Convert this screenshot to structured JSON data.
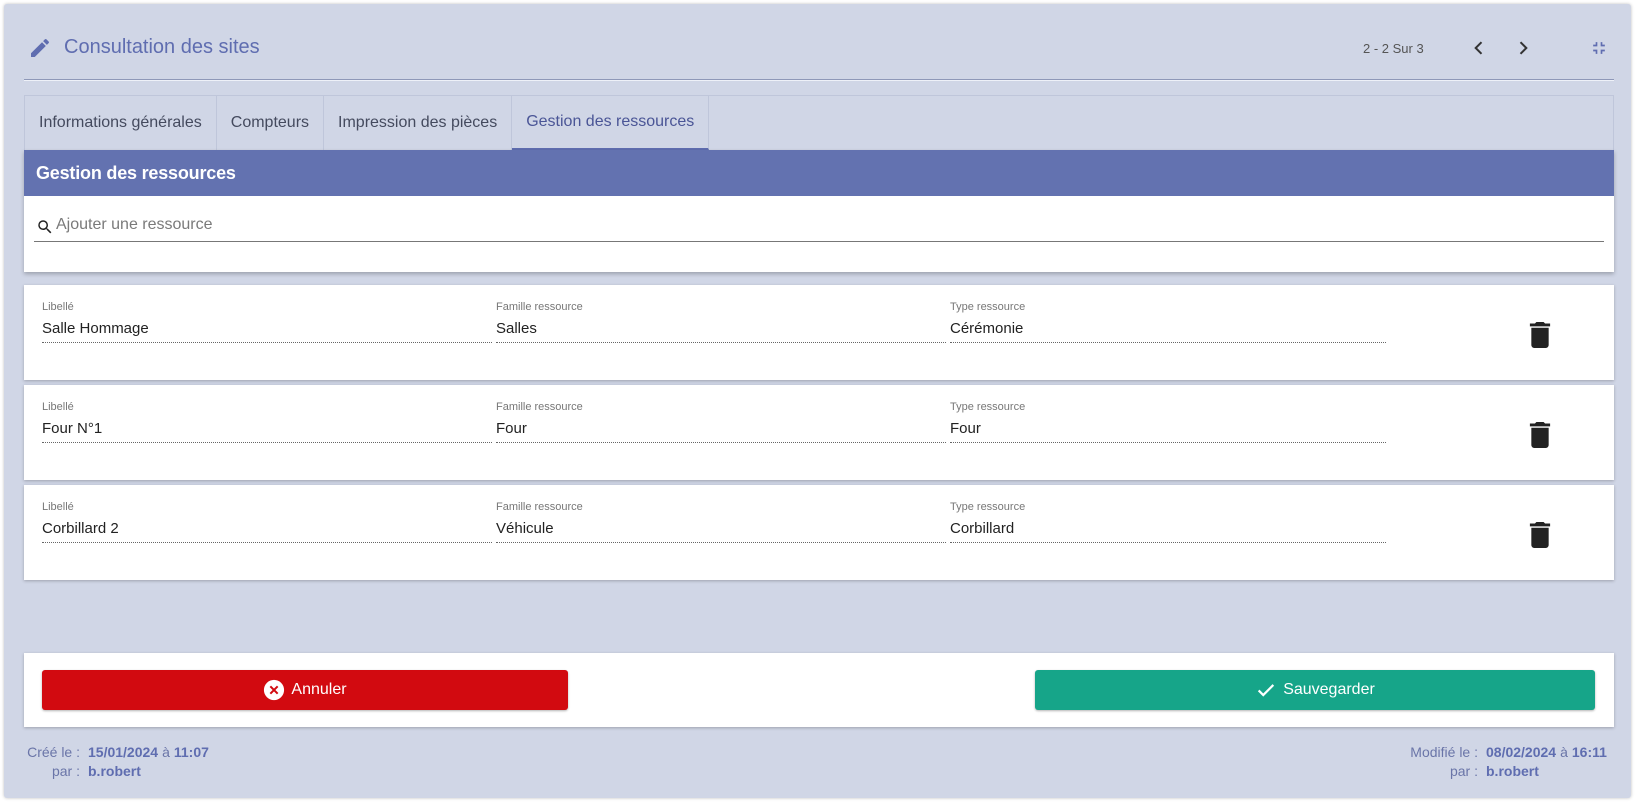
{
  "header": {
    "title": "Consultation des sites",
    "pager": "2 - 2 Sur 3"
  },
  "tabs": [
    {
      "label": "Informations générales",
      "active": false
    },
    {
      "label": "Compteurs",
      "active": false
    },
    {
      "label": "Impression des pièces",
      "active": false
    },
    {
      "label": "Gestion des ressources",
      "active": true
    }
  ],
  "panel": {
    "title": "Gestion des ressources",
    "search_placeholder": "Ajouter une ressource",
    "search_value": ""
  },
  "columns": {
    "libelle": "Libellé",
    "famille": "Famille ressource",
    "type": "Type ressource"
  },
  "resources": [
    {
      "libelle": "Salle Hommage",
      "famille": "Salles",
      "type": "Cérémonie"
    },
    {
      "libelle": "Four N°1",
      "famille": "Four",
      "type": "Four"
    },
    {
      "libelle": "Corbillard 2",
      "famille": "Véhicule",
      "type": "Corbillard"
    }
  ],
  "actions": {
    "cancel_label": "Annuler",
    "save_label": "Sauvegarder"
  },
  "meta": {
    "created_label": "Créé le :",
    "created_date": "15/01/2024",
    "created_at": "à",
    "created_time": "11:07",
    "created_by_label": "par :",
    "created_by": "b.robert",
    "modified_label": "Modifié le :",
    "modified_date": "08/02/2024",
    "modified_at": "à",
    "modified_time": "16:11",
    "modified_by_label": "par :",
    "modified_by": "b.robert"
  },
  "colors": {
    "accent": "#5f6db0",
    "panel_header": "#6372b0",
    "background": "#d0d6e6",
    "cancel": "#d20a10",
    "save": "#16a589"
  },
  "icons": [
    "edit-icon",
    "chevron-left-icon",
    "chevron-right-icon",
    "collapse-icon",
    "search-icon",
    "trash-icon",
    "close-circle-icon",
    "check-icon"
  ]
}
